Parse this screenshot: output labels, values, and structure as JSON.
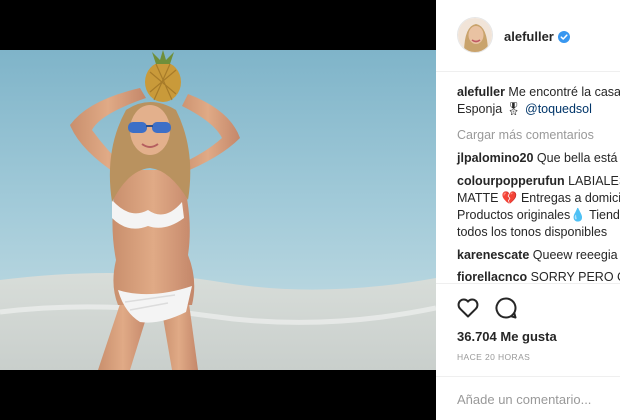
{
  "post": {
    "username": "alefuller",
    "verified": true,
    "avatar": "profile-photo",
    "photo": "beach-photo-with-pineapple"
  },
  "caption": {
    "user": "alefuller",
    "text_line1": "Me encontré la casa",
    "text_line2": "Esponja ",
    "emoji": "🎖",
    "mention": "@toquedsol"
  },
  "load_more": "Cargar más comentarios",
  "comments": [
    {
      "user": "jlpalomino20",
      "text": "Que bella está"
    },
    {
      "user": "colourpopperufun",
      "text": "LABIALES",
      "lines": [
        "MATTE 💔 Entregas a domici",
        "Productos originales💧 Tiend",
        "todos los tonos disponibles"
      ]
    },
    {
      "user": "karenescate",
      "text": "Queew reeegia"
    },
    {
      "user": "fiorellacnco",
      "text": "SORRY PERO CF"
    }
  ],
  "actions": {
    "like_icon": "heart-icon",
    "comment_icon": "comment-bubble-icon",
    "likes": "36.704 Me gusta",
    "time": "HACE 20 HORAS"
  },
  "add_comment": {
    "placeholder": "Añade un comentario..."
  },
  "colors": {
    "mention": "#003569",
    "muted": "#999999",
    "verified": "#3897f0"
  }
}
